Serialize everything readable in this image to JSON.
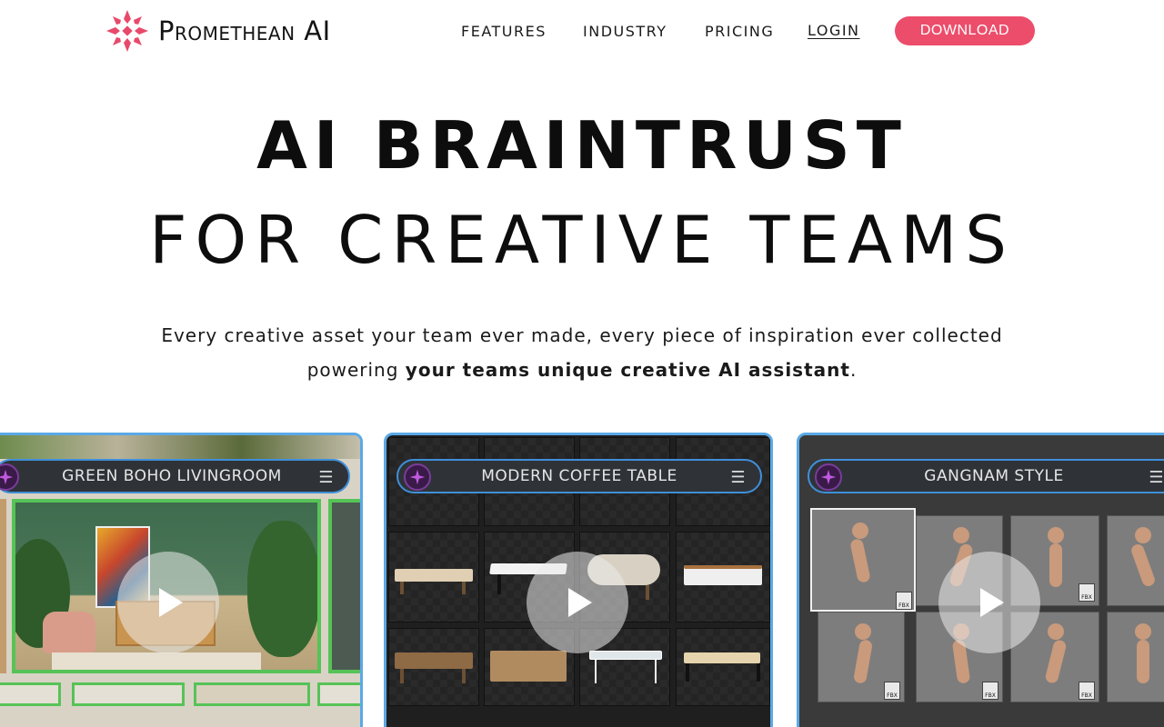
{
  "nav": {
    "logo_text": "Promethean AI",
    "links": [
      "FEATURES",
      "INDUSTRY",
      "PRICING"
    ],
    "login": "LOGIN",
    "download": "DOWNLOAD"
  },
  "hero": {
    "title_line1": "AI BRAINTRUST",
    "title_line2": "FOR CREATIVE TEAMS",
    "subtitle_line1": "Every creative asset your team ever made, every piece of inspiration ever collected",
    "subtitle_pre": "powering ",
    "subtitle_bold": "your teams unique creative AI assistant",
    "subtitle_post": "."
  },
  "cards": [
    {
      "title": "GREEN BOHO LIVINGROOM"
    },
    {
      "title": "MODERN COFFEE TABLE"
    },
    {
      "title": "GANGNAM STYLE"
    }
  ],
  "colors": {
    "accent": "#ec4d6b",
    "card_border": "#5aa9e6",
    "green_frame": "#56c357",
    "logo_mark": "#e8496a"
  },
  "icons": {
    "logo": "star-flower-icon",
    "menu": "hamburger-menu-icon",
    "play": "play-icon",
    "file": "fbx-file-icon"
  }
}
